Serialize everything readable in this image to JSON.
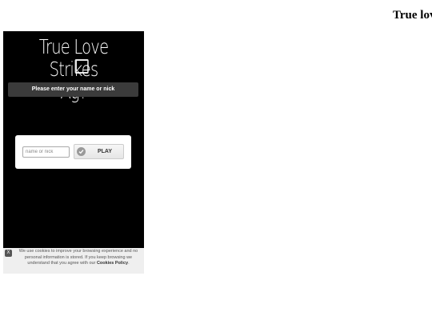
{
  "page": {
    "corner_title": "True lov"
  },
  "game": {
    "title_line1": "True Love Strikes",
    "title_line2": "Ag?",
    "prompt": "Please enter your name or nick",
    "name_input": {
      "placeholder": "name or nick",
      "value": ""
    },
    "play_label": "PLAY",
    "play_icon": "check-icon"
  },
  "cookie": {
    "close_label": "X",
    "text": "We use cookies to improve your browsing experience and no personal information is stored. If you keep browsing we understand that you agree with our",
    "link_label": "Cookies Policy",
    "suffix": "."
  },
  "colors": {
    "game_background": "#000000",
    "prompt_bar": "#3b3b3b",
    "cookie_background": "#efefef"
  }
}
